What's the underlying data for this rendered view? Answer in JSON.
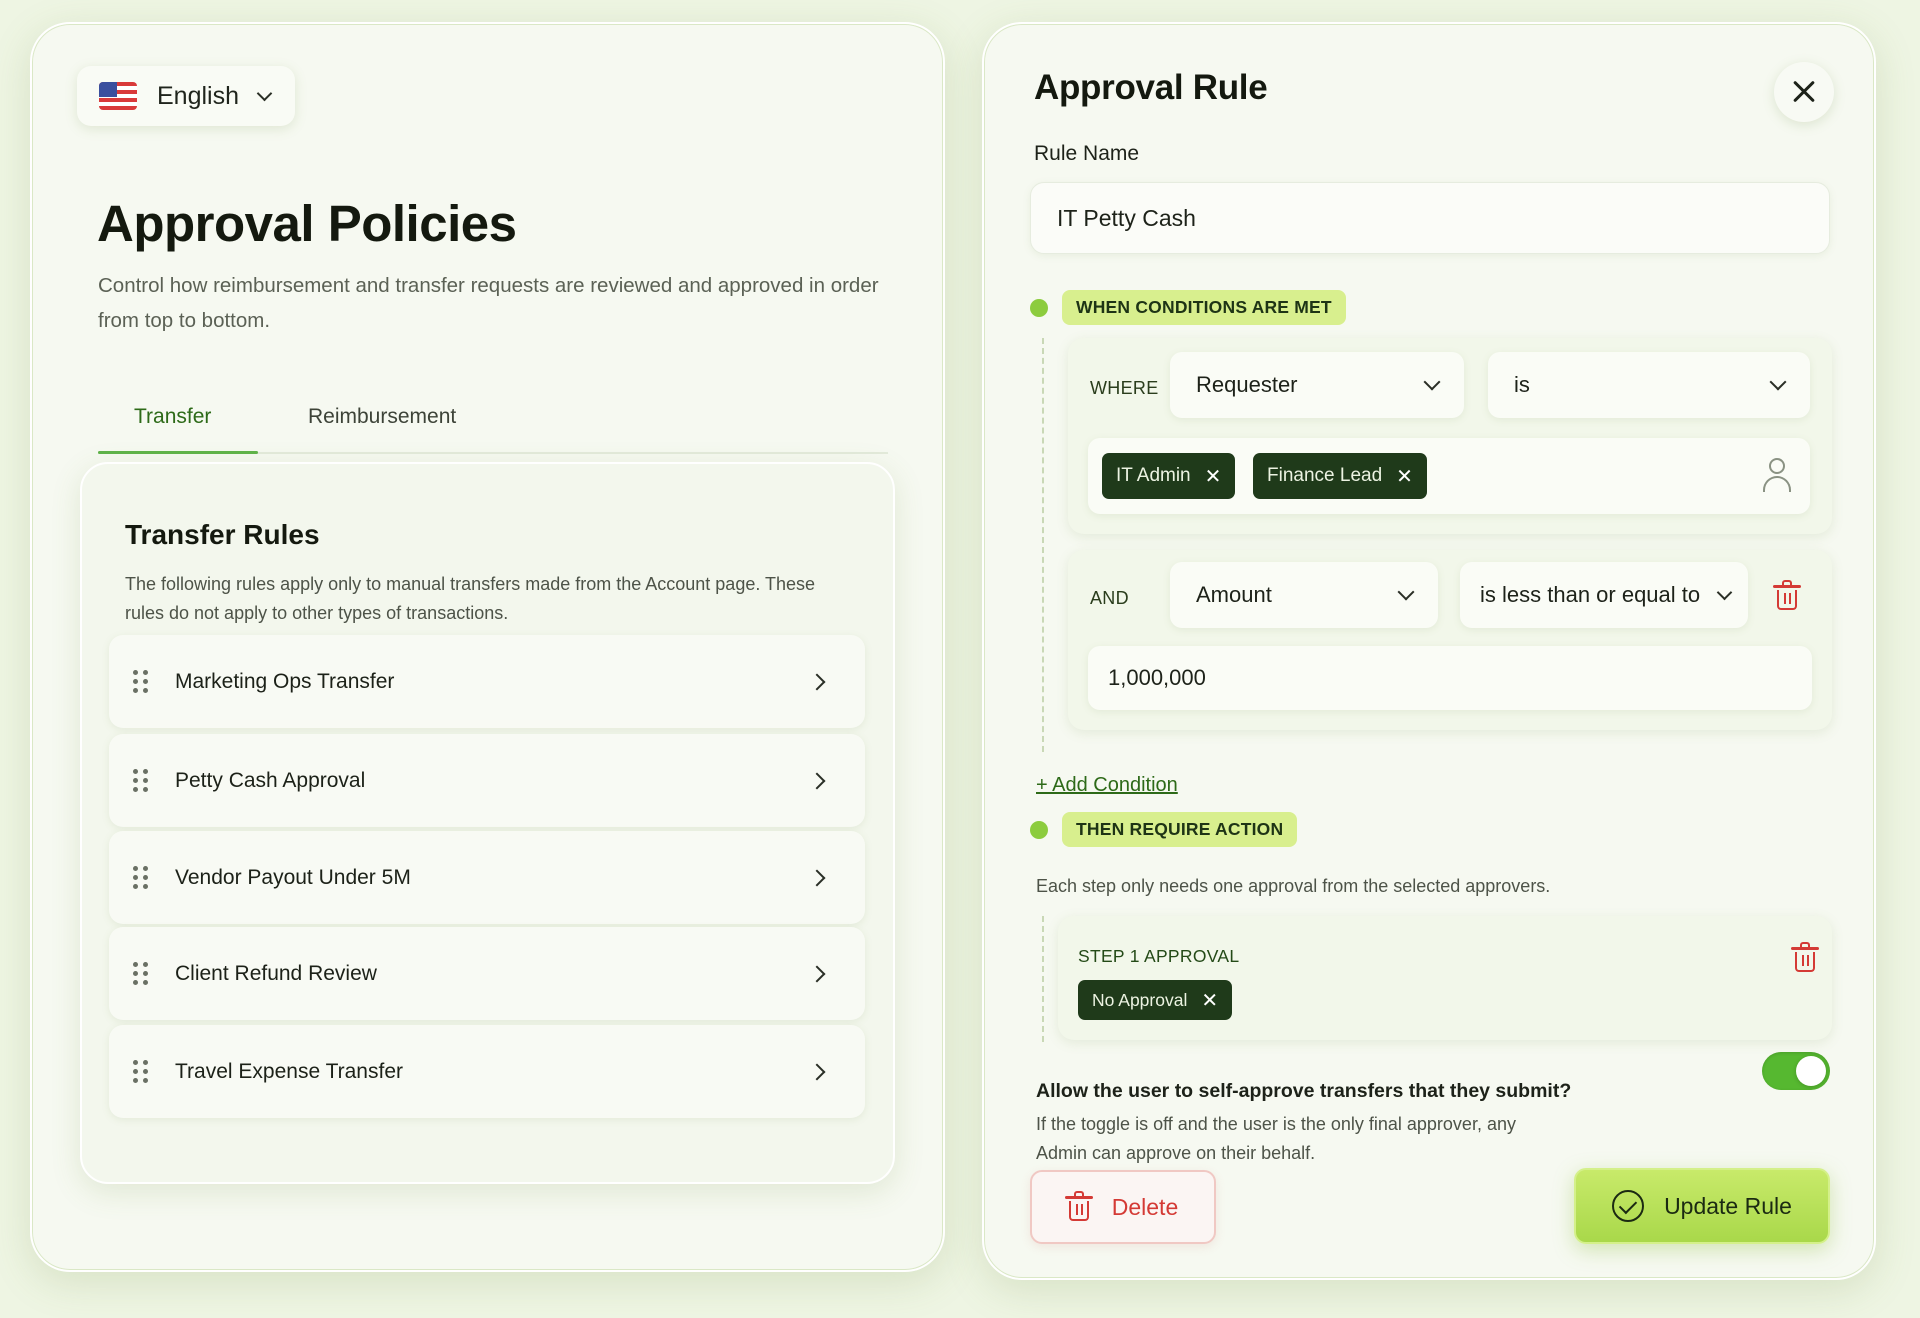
{
  "language": {
    "label": "English"
  },
  "page": {
    "title": "Approval Policies",
    "description": "Control how reimbursement and transfer requests are reviewed and approved in order from top to bottom."
  },
  "tabs": [
    {
      "label": "Transfer",
      "active": true
    },
    {
      "label": "Reimbursement",
      "active": false
    }
  ],
  "transfer_rules": {
    "title": "Transfer Rules",
    "description": "The following rules apply only to manual transfers made from the Account page. These rules do not apply to other types of transactions.",
    "items": [
      {
        "label": "Marketing Ops Transfer"
      },
      {
        "label": "Petty Cash Approval"
      },
      {
        "label": "Vendor Payout Under 5M"
      },
      {
        "label": "Client Refund Review"
      },
      {
        "label": "Travel Expense Transfer"
      }
    ]
  },
  "approval_rule": {
    "title": "Approval Rule",
    "rule_name_label": "Rule Name",
    "rule_name_value": "IT Petty Cash",
    "conditions_heading": "WHEN CONDITIONS ARE MET",
    "condition_1": {
      "keyword": "WHERE",
      "field": "Requester",
      "operator": "is",
      "tags": [
        "IT Admin",
        "Finance Lead"
      ]
    },
    "condition_2": {
      "keyword": "AND",
      "field": "Amount",
      "operator": "is less than or equal to",
      "value": "1,000,000"
    },
    "add_condition": "+ Add Condition",
    "action_heading": "THEN REQUIRE ACTION",
    "action_description": "Each step only needs one approval from the selected approvers.",
    "step_1": {
      "title": "STEP 1 APPROVAL",
      "tags": [
        "No Approval"
      ]
    },
    "self_approve": {
      "question": "Allow the user to self-approve transfers that they submit?",
      "description": "If the toggle is off and the user is the only final approver, any Admin can approve on their behalf.",
      "enabled": true
    },
    "delete_label": "Delete",
    "update_label": "Update Rule"
  },
  "colors": {
    "accent_green": "#5fb34a",
    "tag_dark": "#1f3a1a",
    "pill_lime": "#d8ef8e",
    "danger": "#d43a35",
    "update_button": "#b8e05a"
  }
}
